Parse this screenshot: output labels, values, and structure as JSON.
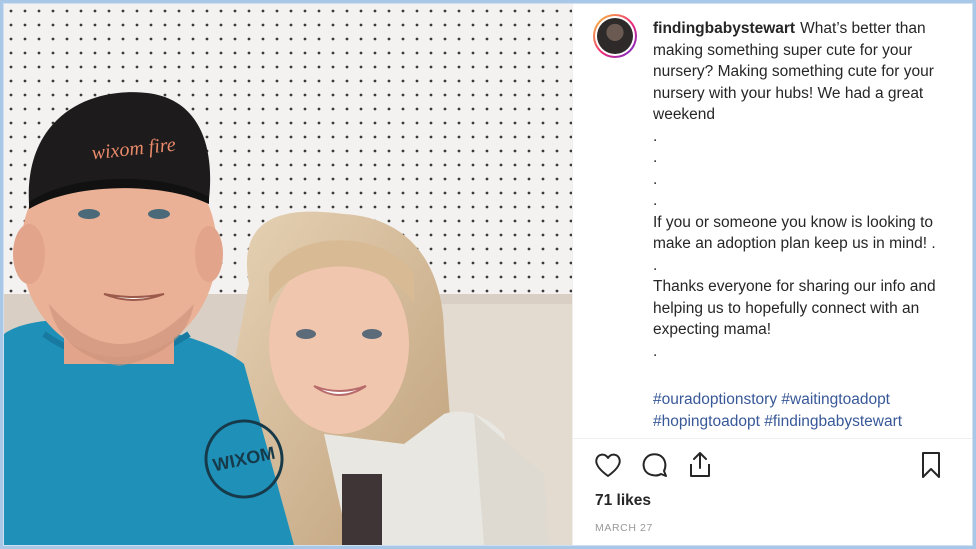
{
  "post": {
    "username": "findingbabystewart",
    "caption_lines": [
      "What’s better than making something super cute for your nursery? Making something cute for your nursery with your hubs! We had a great weekend",
      ".",
      ".",
      ".",
      ".",
      "If you or someone you know is looking to make an adoption plan keep us in mind! .",
      ".",
      "Thanks everyone for sharing our info and helping us to hopefully connect with an expecting mama!",
      "."
    ],
    "hashtags": [
      "#ouradoptionstory",
      "#waitingtoadopt",
      "#hopingtoadopt",
      "#findingbabystewart"
    ],
    "likes": "71 likes",
    "date": "MARCH 27"
  },
  "photo": {
    "hat_text": "wixom fire",
    "shirt_text": "WIXOM"
  },
  "icons": {
    "like": "heart-icon",
    "comment": "comment-icon",
    "share": "share-icon",
    "save": "bookmark-icon"
  },
  "colors": {
    "border": "#a9c7e6",
    "hashtag": "#385898",
    "text": "#262626",
    "muted": "#999999"
  }
}
